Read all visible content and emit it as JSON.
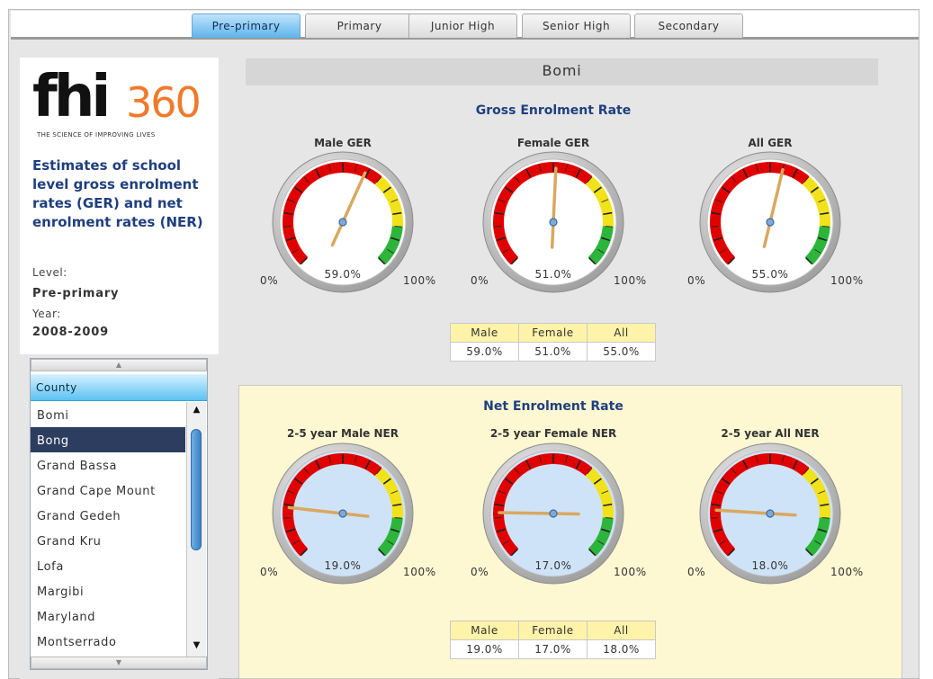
{
  "tabs": [
    {
      "label": "Pre-primary",
      "active": true
    },
    {
      "label": "Primary",
      "active": false
    },
    {
      "label": "Junior High",
      "active": false
    },
    {
      "label": "Senior High",
      "active": false
    },
    {
      "label": "Secondary",
      "active": false
    }
  ],
  "sidebar": {
    "logo": {
      "brand": "fhi",
      "number": "360",
      "tagline": "THE SCIENCE OF IMPROVING LIVES"
    },
    "description": "Estimates of school level gross enrolment rates (GER) and net enrolment rates (NER)",
    "level_label": "Level:",
    "level_value": "Pre-primary",
    "year_label": "Year:",
    "year_value": "2008-2009",
    "county_header": "County",
    "counties": [
      "Bomi",
      "Bong",
      "Grand Bassa",
      "Grand Cape Mount",
      "Grand Gedeh",
      "Grand Kru",
      "Lofa",
      "Margibi",
      "Maryland",
      "Montserrado"
    ],
    "selected_county": "Bong"
  },
  "main": {
    "county_title": "Bomi",
    "ger": {
      "title": "Gross Enrolment Rate",
      "gauges": [
        {
          "label": "Male GER",
          "value": 59.0,
          "display": "59.0%"
        },
        {
          "label": "Female GER",
          "value": 51.0,
          "display": "51.0%"
        },
        {
          "label": "All GER",
          "value": 55.0,
          "display": "55.0%"
        }
      ],
      "min_label": "0%",
      "max_label": "100%",
      "table": {
        "headers": [
          "Male",
          "Female",
          "All"
        ],
        "values": [
          "59.0%",
          "51.0%",
          "55.0%"
        ]
      }
    },
    "ner": {
      "title": "Net Enrolment Rate",
      "gauges": [
        {
          "label": "2-5 year Male NER",
          "value": 19.0,
          "display": "19.0%"
        },
        {
          "label": "2-5 year Female NER",
          "value": 17.0,
          "display": "17.0%"
        },
        {
          "label": "2-5 year All NER",
          "value": 18.0,
          "display": "18.0%"
        }
      ],
      "min_label": "0%",
      "max_label": "100%",
      "table": {
        "headers": [
          "Male",
          "Female",
          "All"
        ],
        "values": [
          "19.0%",
          "17.0%",
          "18.0%"
        ]
      }
    }
  },
  "colors": {
    "red": "#e00000",
    "yellow": "#f2e21a",
    "green": "#2db53b",
    "needle": "#d9a860",
    "ner_face": "#cfe3f8",
    "title_blue": "#1f3f7f",
    "ner_bg": "#fdf7d2"
  }
}
